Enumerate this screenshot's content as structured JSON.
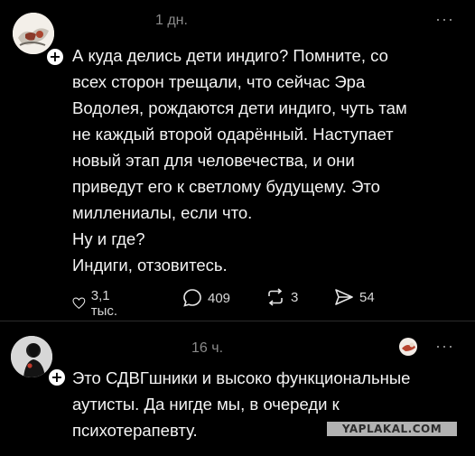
{
  "posts": [
    {
      "time": "1 дн.",
      "more": "···",
      "follow": "+",
      "text": "А куда делись дети индиго? Помните, со\nвсех сторон трещали, что сейчас Эра\nВодолея, рождаются дети индиго, чуть там\nне каждый второй одарённый. Наступает\nновый этап для человечества, и они\nприведут его к светлому будущему. Это\nмиллениалы, если что.\nНу и где?\nИндиги, отзовитесь.",
      "actions": {
        "likes": "3,1 тыс.",
        "replies": "409",
        "reposts": "3",
        "shares": "54"
      }
    },
    {
      "time": "16 ч.",
      "more": "···",
      "follow": "+",
      "text": "Это СДВГшники и высоко функциональные\nаутисты. Да нигде мы, в очереди к\nпсихотерапевту."
    }
  ],
  "watermark": "YAPLAKAL.COM"
}
